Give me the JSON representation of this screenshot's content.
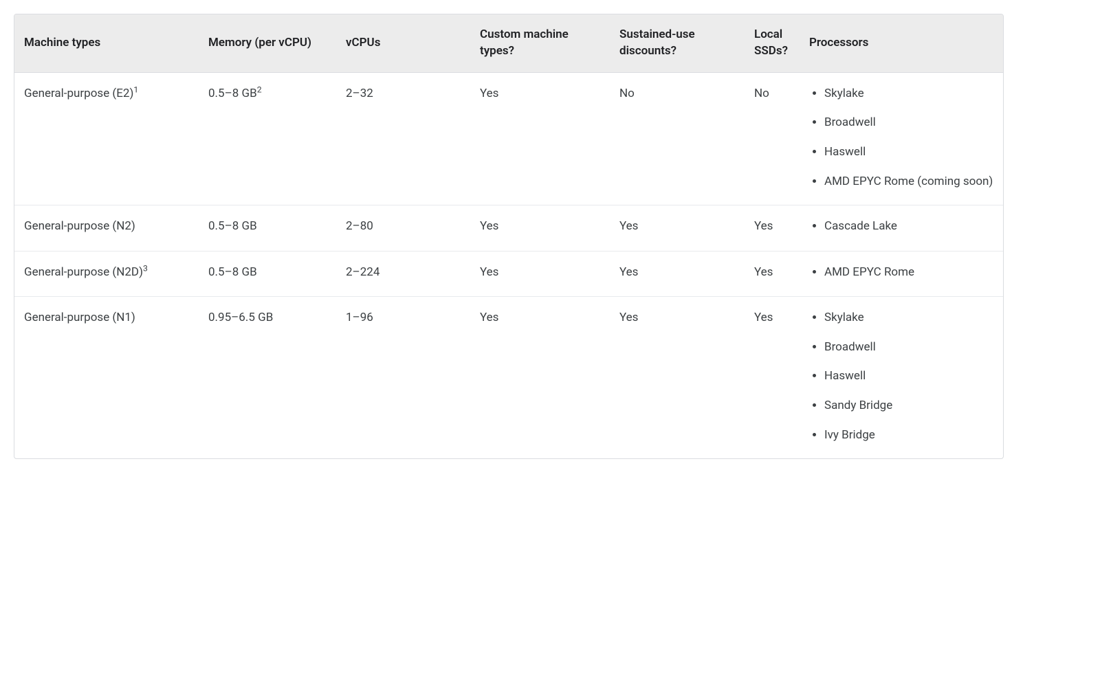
{
  "table": {
    "headers": {
      "machine_types": "Machine types",
      "memory": "Memory (per vCPU)",
      "vcpus": "vCPUs",
      "custom": "Custom machine types?",
      "sustained": "Sustained-use discounts?",
      "local_ssd": "Local SSDs?",
      "processors": "Processors"
    },
    "rows": [
      {
        "type_text": "General-purpose (E2)",
        "type_sup": "1",
        "mem_text": "0.5–8 GB",
        "mem_sup": "2",
        "vcpus": "2–32",
        "custom": "Yes",
        "sustained": "No",
        "local_ssd": "No",
        "processors": [
          "Skylake",
          "Broadwell",
          "Haswell",
          "AMD EPYC Rome (coming soon)"
        ]
      },
      {
        "type_text": "General-purpose (N2)",
        "type_sup": "",
        "mem_text": "0.5–8 GB",
        "mem_sup": "",
        "vcpus": "2–80",
        "custom": "Yes",
        "sustained": "Yes",
        "local_ssd": "Yes",
        "processors": [
          "Cascade Lake"
        ]
      },
      {
        "type_text": "General-purpose (N2D)",
        "type_sup": "3",
        "mem_text": "0.5–8 GB",
        "mem_sup": "",
        "vcpus": "2–224",
        "custom": "Yes",
        "sustained": "Yes",
        "local_ssd": "Yes",
        "processors": [
          "AMD EPYC Rome"
        ]
      },
      {
        "type_text": "General-purpose (N1)",
        "type_sup": "",
        "mem_text": "0.95–6.5 GB",
        "mem_sup": "",
        "vcpus": "1–96",
        "custom": "Yes",
        "sustained": "Yes",
        "local_ssd": "Yes",
        "processors": [
          "Skylake",
          "Broadwell",
          "Haswell",
          "Sandy Bridge",
          "Ivy Bridge"
        ]
      }
    ]
  }
}
